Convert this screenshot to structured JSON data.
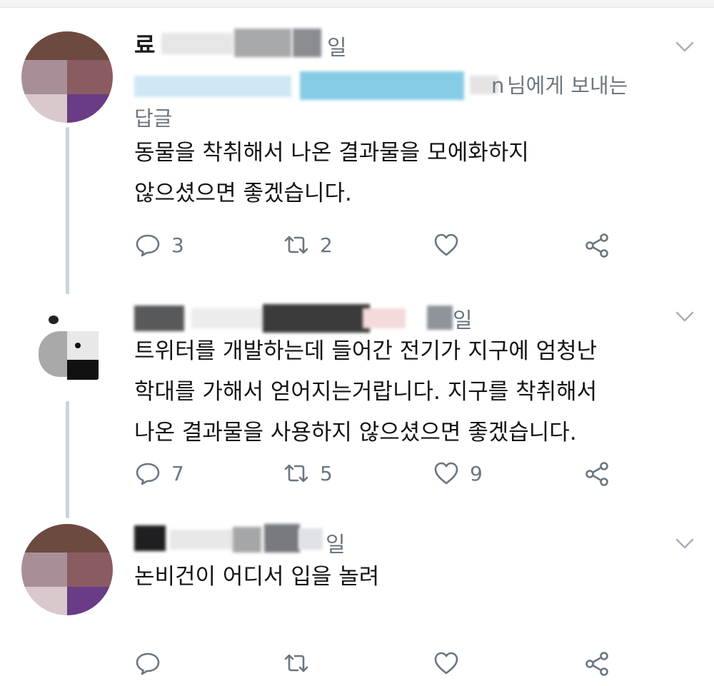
{
  "tweets": [
    {
      "name_fragment": "료",
      "time_suffix": "일",
      "reply_to_suffix": "n",
      "reply_to_text": "님에게 보내는",
      "reply_to_line2": "답글",
      "text_lines": [
        "동물을 착취해서 나온 결과물을 모에화하지",
        "않으셨으면 좋겠습니다."
      ],
      "reply_count": "3",
      "retweet_count": "2",
      "like_count": ""
    },
    {
      "time_suffix": "일",
      "text_lines": [
        "트위터를 개발하는데 들어간 전기가 지구에 엄청난",
        "학대를 가해서 얻어지는거랍니다. 지구를 착취해서",
        "나온 결과물을 사용하지 않으셨으면 좋겠습니다."
      ],
      "reply_count": "7",
      "retweet_count": "5",
      "like_count": "9"
    },
    {
      "time_suffix": "일",
      "text_lines": [
        "논비건이 어디서 입을 놀려"
      ],
      "reply_count": "",
      "retweet_count": "",
      "like_count": ""
    }
  ],
  "colors": {
    "icon": "#6b7680",
    "thread": "#c9d3dc",
    "text": "#151515"
  },
  "icons": [
    "reply-icon",
    "retweet-icon",
    "like-icon",
    "share-icon",
    "chevron-down-icon"
  ]
}
